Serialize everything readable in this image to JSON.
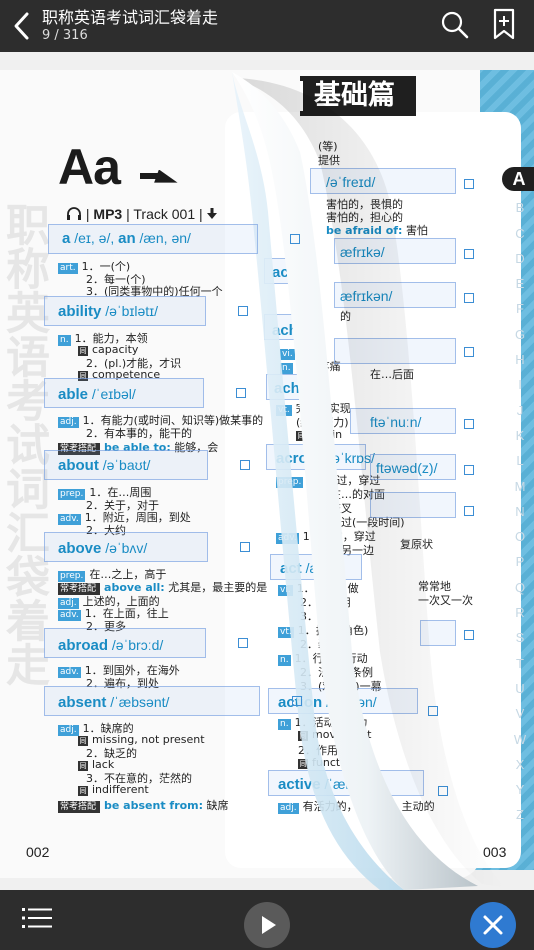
{
  "header": {
    "title": "职称英语考试词汇袋着走",
    "page_counter": "9 / 316"
  },
  "colors": {
    "accent": "#1a8cc4",
    "close_button": "#2f7ad1",
    "page_border": "#5db7de",
    "bar": "#2d2d2d"
  },
  "left_page": {
    "letter": "Aa",
    "track": {
      "mp3": "MP3",
      "sep": "|",
      "track": "Track 001"
    },
    "watermark": "职称英语考试词汇袋着走",
    "page_number": "002",
    "entries": [
      {
        "headword": "a",
        "phon": "/eɪ, ə/,",
        "alt": "an",
        "alt_phon": "/æn, ən/",
        "lines": [
          {
            "pos": "art.",
            "text": "1．一(个)"
          },
          {
            "pos": "",
            "text": "2．每一(个)"
          },
          {
            "pos": "",
            "text": "3．(同类事物中的)任何一个"
          }
        ]
      },
      {
        "headword": "ability",
        "phon": "/əˈbɪlətɪ/",
        "lines": [
          {
            "pos": "n.",
            "text": "1．能力，本领"
          },
          {
            "pos": "",
            "text": "capacity",
            "syn": "同"
          },
          {
            "pos": "",
            "text": "2．(pl.)才能，才识"
          },
          {
            "pos": "",
            "text": "competence",
            "syn": "同"
          }
        ]
      },
      {
        "headword": "able",
        "phon": "/ˈeɪbəl/",
        "lines": [
          {
            "pos": "adj.",
            "text": "1．有能力(或时间、知识等)做某事的"
          },
          {
            "pos": "",
            "text": "2．有本事的，能干的"
          }
        ],
        "phrase_tag": "常考搭配",
        "phrase": "be able to:",
        "phrase_meaning": "能够，会"
      },
      {
        "headword": "about",
        "phon": "/əˈbaʊt/",
        "lines": [
          {
            "pos": "prep.",
            "text": "1．在…周围"
          },
          {
            "pos": "",
            "text": "2．关于，对于"
          },
          {
            "pos": "adv.",
            "text": "1．附近，周围，到处"
          },
          {
            "pos": "",
            "text": "2．大约"
          }
        ]
      },
      {
        "headword": "above",
        "phon": "/əˈbʌv/",
        "lines": [
          {
            "pos": "prep.",
            "text": "在…之上，高于"
          }
        ],
        "phrase_tag": "常考搭配",
        "phrase": "above all:",
        "phrase_meaning": "尤其是，最主要的是",
        "lines2": [
          {
            "pos": "adj.",
            "text": "上述的，上面的"
          },
          {
            "pos": "adv.",
            "text": "1．在上面，往上"
          },
          {
            "pos": "",
            "text": "2．更多"
          }
        ]
      },
      {
        "headword": "abroad",
        "phon": "/əˈbrɔːd/",
        "lines": [
          {
            "pos": "adv.",
            "text": "1．到国外，在海外"
          },
          {
            "pos": "",
            "text": "2．遍布，到处"
          }
        ]
      },
      {
        "headword": "absent",
        "phon": "/ˈæbsənt/",
        "lines": [
          {
            "pos": "adj.",
            "text": "1．缺席的"
          },
          {
            "pos": "",
            "text": "missing, not present",
            "syn": "同"
          },
          {
            "pos": "",
            "text": "2．缺乏的"
          },
          {
            "pos": "",
            "text": "lack",
            "syn": "同"
          },
          {
            "pos": "",
            "text": "3．不在意的，茫然的"
          },
          {
            "pos": "",
            "text": "indifferent",
            "syn": "同"
          }
        ],
        "phrase_tag": "常考搭配",
        "phrase": "be absent from:",
        "phrase_meaning": "缺席"
      }
    ]
  },
  "right_page": {
    "header": "基础篇",
    "page_number": "003",
    "visible_text": {
      "frag1": "(等)",
      "frag2": "提供",
      "afraid_phon": "/əˈfreɪd/",
      "afraid_1": "害怕的，畏惧的",
      "afraid_2": "害怕的，担心的",
      "afraid_phrase": "be afraid of:",
      "afraid_phrase_m": "害怕",
      "africa_phon": "æfrɪkə/",
      "african_phon": "æfrɪkən/",
      "african_m": "的",
      "acc": "acc",
      "ache": "ache",
      "ache_1": "痛",
      "ache_2": "痛，疼痛",
      "ache_3": "在…后面",
      "achieve": "achieve",
      "achieve_1": "完成，实现",
      "achieve_2": "(经过努力)",
      "achieve_syn": "attain",
      "afternoon_phon": "ftəˈnuːn/",
      "across": "across",
      "across_phon": "/əˈkrɒs/",
      "across_1": "1．横过，穿过",
      "across_2": "2．在…的对面",
      "across_3": "3．交叉",
      "across_4": "4．经过(一段时间)",
      "across_adv_1": "1．横过，穿过",
      "across_adv_2": "2．在另一边",
      "afterwards_phon": "ftəwəd(z)/",
      "shape": "复原状",
      "act": "act",
      "act_phon": "/ækt/",
      "act_vi_1": "1．行动，做",
      "act_vi_2": "2．起作用",
      "act_vi_3": "3．表演",
      "act_vt_1": "1．扮演(角色)",
      "act_vt_2": "2．装作",
      "act_n_1": "1．行为，行动",
      "act_n_2": "2．法令，条例",
      "act_n_3": "3．(戏剧的)一幕",
      "often": "常常地",
      "again": "一次又一次",
      "action": "action",
      "action_phon": "/ˈækʃən/",
      "action_1": "1．活动，行为",
      "action_syn1": "movement",
      "action_2": "2．作用",
      "action_syn2": "function",
      "active": "active",
      "active_phon": "/ˈæktɪv/",
      "active_1": "有活力的，积极的，主动的"
    }
  },
  "alphabet": [
    "A",
    "B",
    "C",
    "D",
    "E",
    "F",
    "G",
    "H",
    "I",
    "J",
    "K",
    "L",
    "M",
    "N",
    "O",
    "P",
    "Q",
    "R",
    "S",
    "T",
    "U",
    "V",
    "W",
    "X",
    "Y",
    "Z"
  ],
  "alphabet_active": "A"
}
